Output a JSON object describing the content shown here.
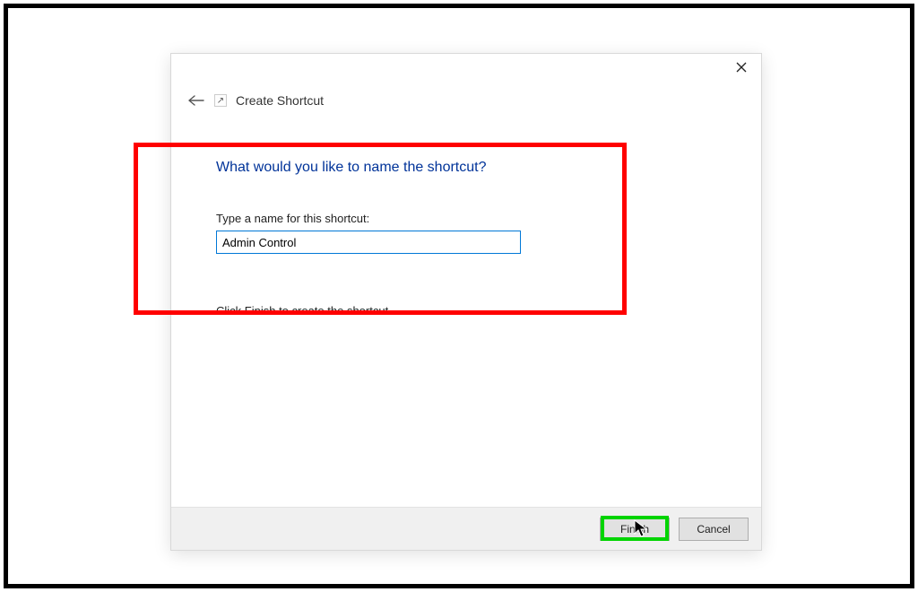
{
  "dialog": {
    "wizard_title": "Create Shortcut",
    "heading": "What would you like to name the shortcut?",
    "field_label": "Type a name for this shortcut:",
    "input_value": "Admin Control",
    "hint": "Click Finish to create the shortcut.",
    "buttons": {
      "finish": "Finish",
      "cancel": "Cancel"
    }
  },
  "annotations": {
    "red_highlight": true,
    "green_highlight_on": "finish-button",
    "cursor_on": "finish-button"
  }
}
